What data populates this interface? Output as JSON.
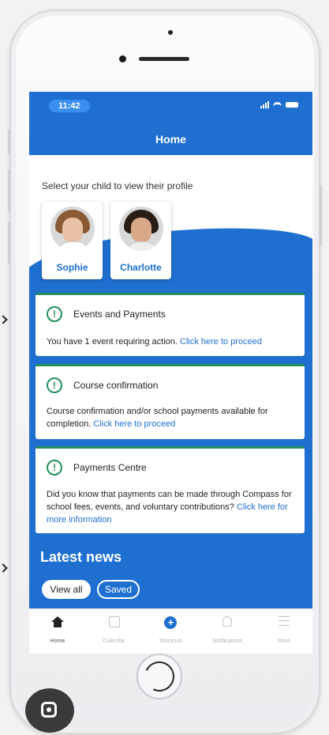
{
  "status_bar": {
    "time": "11:42"
  },
  "header": {
    "title": "Home"
  },
  "profile": {
    "prompt": "Select your child to view their profile",
    "children": [
      {
        "name": "Sophie"
      },
      {
        "name": "Charlotte"
      }
    ]
  },
  "cards": [
    {
      "title": "Events and Payments",
      "body": "You have 1 event requiring action.",
      "link": "Click here to proceed"
    },
    {
      "title": "Course confirmation",
      "body": "Course confirmation and/or school payments available for completion.",
      "link": "Click here to proceed"
    },
    {
      "title": "Payments Centre",
      "body": "Did you know that payments can be made through Compass for school fees, events, and voluntary contributions?",
      "link": "Click here for more information"
    }
  ],
  "news": {
    "title": "Latest news",
    "filters": [
      "View all",
      "Saved"
    ]
  },
  "tab_bar": {
    "items": [
      {
        "label": "Home",
        "icon": "home-icon"
      },
      {
        "label": "Calendar",
        "icon": "calendar-icon"
      },
      {
        "label": "Shortcuts",
        "icon": "plus-circle-icon"
      },
      {
        "label": "Notifications",
        "icon": "bell-icon"
      },
      {
        "label": "More",
        "icon": "menu-icon"
      }
    ]
  },
  "colors": {
    "brand_blue": "#1f6fd1",
    "alert_green": "#22905a"
  }
}
